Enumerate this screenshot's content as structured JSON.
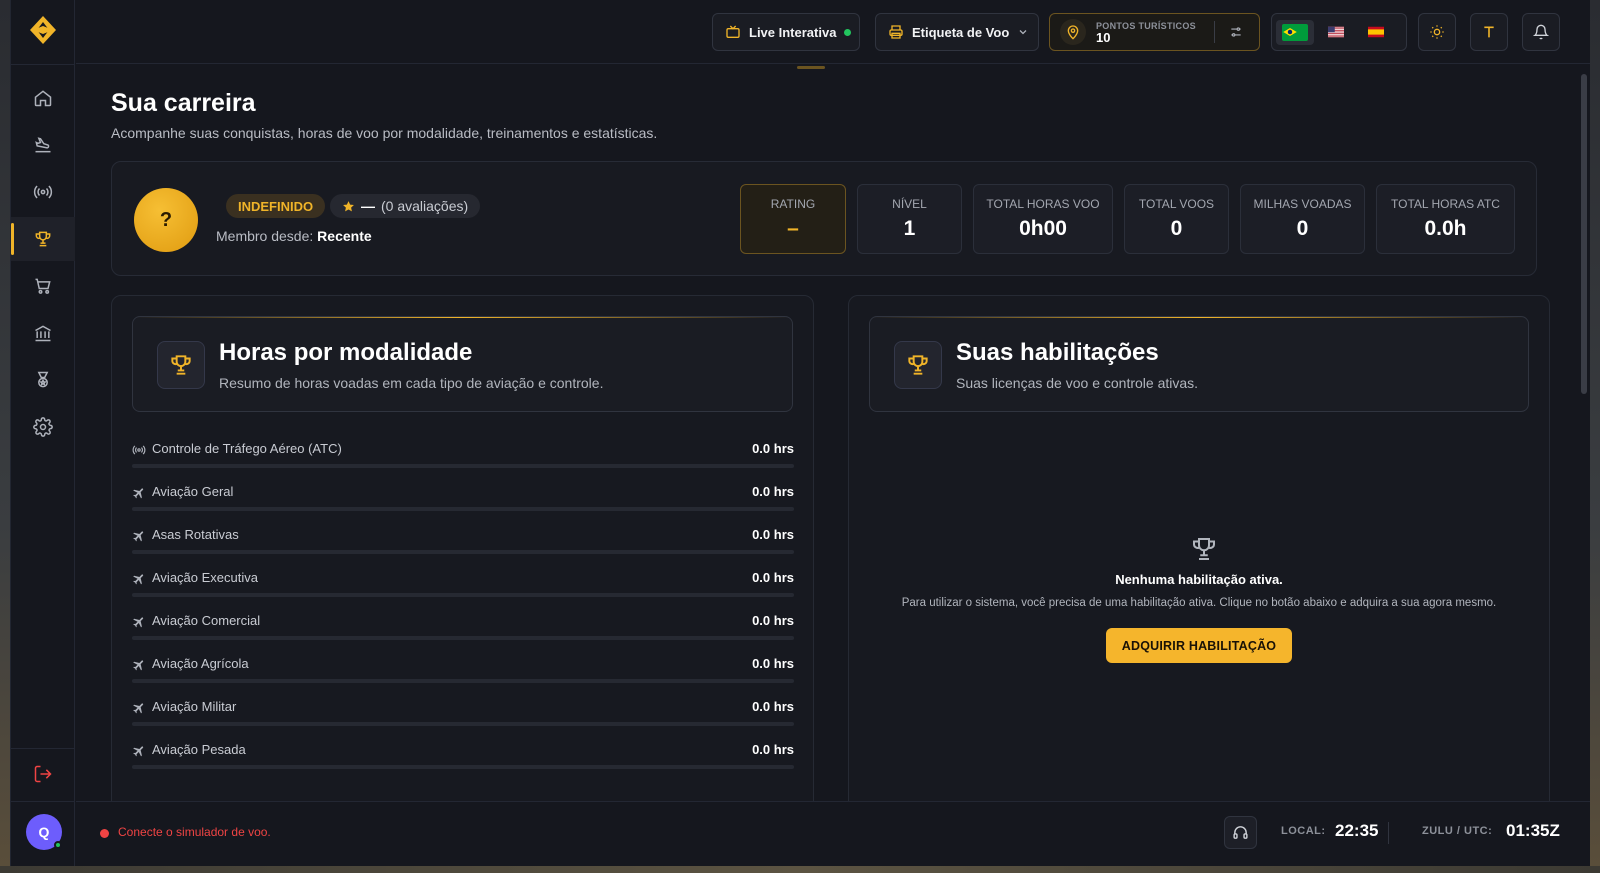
{
  "topbar": {
    "live_label": "Live Interativa",
    "etiqueta_label": "Etiqueta de Voo",
    "points_label": "PONTOS TURÍSTICOS",
    "points_value": "10",
    "languages": [
      "pt-BR",
      "en-US",
      "es-ES"
    ],
    "selected_language": "pt-BR"
  },
  "page": {
    "title": "Sua carreira",
    "subtitle": "Acompanhe suas conquistas, horas de voo por modalidade, treinamentos e estatísticas."
  },
  "profile": {
    "badge": "?",
    "rank": "INDEFINIDO",
    "rating_stars": "—",
    "reviews": "(0 avaliações)",
    "member_since_label": "Membro desde:",
    "member_since_value": "Recente",
    "stats": [
      {
        "label": "RATING",
        "value": "–"
      },
      {
        "label": "NÍVEL",
        "value": "1"
      },
      {
        "label": "TOTAL HORAS VOO",
        "value": "0h00"
      },
      {
        "label": "TOTAL VOOS",
        "value": "0"
      },
      {
        "label": "MILHAS VOADAS",
        "value": "0"
      },
      {
        "label": "TOTAL HORAS ATC",
        "value": "0.0h"
      }
    ]
  },
  "hours_panel": {
    "title": "Horas por modalidade",
    "subtitle": "Resumo de horas voadas em cada tipo de aviação e controle.",
    "rows": [
      {
        "name": "Controle de Tráfego Aéreo (ATC)",
        "value": "0.0 hrs",
        "icon": "radio-icon"
      },
      {
        "name": "Aviação Geral",
        "value": "0.0 hrs",
        "icon": "plane-icon"
      },
      {
        "name": "Asas Rotativas",
        "value": "0.0 hrs",
        "icon": "plane-icon"
      },
      {
        "name": "Aviação Executiva",
        "value": "0.0 hrs",
        "icon": "plane-icon"
      },
      {
        "name": "Aviação Comercial",
        "value": "0.0 hrs",
        "icon": "plane-icon"
      },
      {
        "name": "Aviação Agrícola",
        "value": "0.0 hrs",
        "icon": "plane-icon"
      },
      {
        "name": "Aviação Militar",
        "value": "0.0 hrs",
        "icon": "plane-icon"
      },
      {
        "name": "Aviação Pesada",
        "value": "0.0 hrs",
        "icon": "plane-icon"
      }
    ]
  },
  "licenses_panel": {
    "title": "Suas habilitações",
    "subtitle": "Suas licenças de voo e controle ativas.",
    "empty_title": "Nenhuma habilitação ativa.",
    "empty_desc": "Para utilizar o sistema, você precisa de uma habilitação ativa. Clique no botão abaixo e adquira a sua agora mesmo.",
    "cta": "ADQUIRIR HABILITAÇÃO"
  },
  "footer": {
    "connection": "Conecte o simulador de voo.",
    "local_label": "LOCAL:",
    "local_time": "22:35",
    "zulu_label": "ZULU / UTC:",
    "zulu_time": "01:35Z"
  },
  "user": {
    "initial": "Q"
  },
  "colors": {
    "accent": "#f0b429",
    "danger": "#ef4444",
    "online": "#22c55e"
  }
}
